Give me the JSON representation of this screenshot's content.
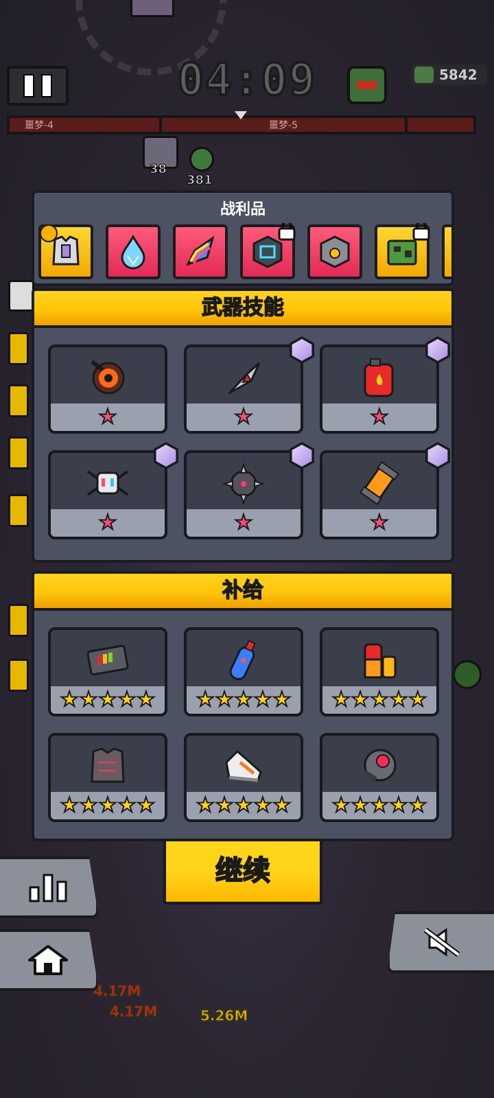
{
  "hud": {
    "timer": "04:09",
    "kill_count": "5842",
    "stage_left": "噩梦-4",
    "stage_right": "噩梦-5"
  },
  "background": {
    "labels": [
      "38",
      "381"
    ],
    "damage_popups": [
      "4.17M",
      "4.17M",
      "5.26M"
    ]
  },
  "loot": {
    "title": "战利品",
    "items": [
      {
        "icon": "armor-vest-icon",
        "frame": "gold",
        "badge": "crown"
      },
      {
        "icon": "water-drop-icon",
        "frame": "pink"
      },
      {
        "icon": "rainbow-horn-icon",
        "frame": "pink"
      },
      {
        "icon": "crystal-cube-icon",
        "frame": "pink",
        "locked": true
      },
      {
        "icon": "metal-box-icon",
        "frame": "pink"
      },
      {
        "icon": "circuit-board-icon",
        "frame": "gold",
        "locked": true
      },
      {
        "icon": "partial-item-icon",
        "frame": "gold"
      }
    ]
  },
  "weapon_skills": {
    "title": "武器技能",
    "items": [
      {
        "icon": "lava-drill-icon",
        "stars": 1,
        "badge": null
      },
      {
        "icon": "kunai-icon",
        "stars": 1,
        "badge": "gear-badge"
      },
      {
        "icon": "fuel-can-icon",
        "stars": 1,
        "badge": "mask-badge"
      },
      {
        "icon": "drone-icon",
        "stars": 1,
        "badge": "gear-badge"
      },
      {
        "icon": "spiked-ball-icon",
        "stars": 1,
        "badge": "robot-badge"
      },
      {
        "icon": "energy-canister-icon",
        "stars": 1,
        "badge": "battery-badge"
      }
    ]
  },
  "supplies": {
    "title": "补给",
    "items": [
      {
        "icon": "battery-pack-icon",
        "stars": 5
      },
      {
        "icon": "oxygen-tank-icon",
        "stars": 5
      },
      {
        "icon": "energy-drink-icon",
        "stars": 5
      },
      {
        "icon": "armor-plate-icon",
        "stars": 5
      },
      {
        "icon": "sneaker-icon",
        "stars": 5
      },
      {
        "icon": "red-core-icon",
        "stars": 5
      }
    ]
  },
  "buttons": {
    "continue": "继续"
  },
  "colors": {
    "accent_yellow": "#ffc50a",
    "star_pink": "#ff4a78",
    "star_gold": "#ffd21a",
    "panel": "#4d5263"
  }
}
